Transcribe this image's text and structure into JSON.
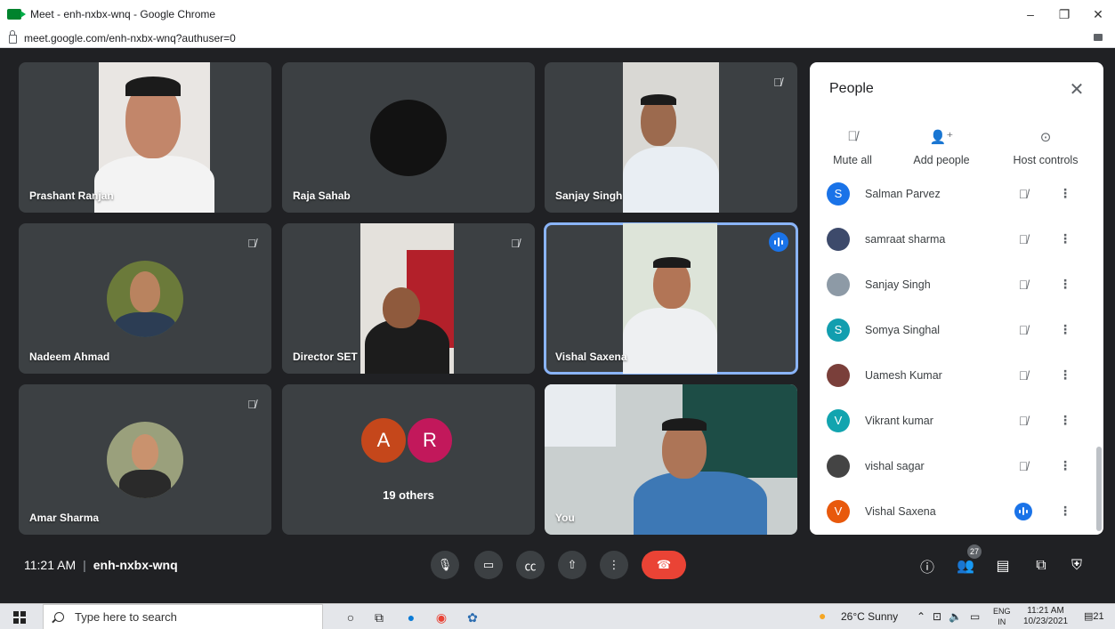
{
  "window": {
    "title": "Meet - enh-nxbx-wnq - Google Chrome",
    "controls": {
      "minimize": "–",
      "restore": "❐",
      "close": "✕"
    }
  },
  "address_bar": {
    "url": "meet.google.com/enh-nxbx-wnq?authuser=0"
  },
  "tiles": {
    "t1": {
      "name": "Prashant Ranjan"
    },
    "t2": {
      "name": "Raja Sahab"
    },
    "t3": {
      "name": "Sanjay Singh"
    },
    "t4": {
      "name": "Nadeem Ahmad"
    },
    "t5": {
      "name": "Director SET"
    },
    "t6": {
      "name": "Vishal Saxena"
    },
    "t7": {
      "name": "Amar Sharma"
    },
    "t8": {
      "label": "19 others",
      "avatars": [
        "A",
        "R"
      ]
    },
    "t9": {
      "name": "You"
    }
  },
  "people_panel": {
    "title": "People",
    "actions": {
      "mute_all": "Mute all",
      "add_people": "Add people",
      "host_controls": "Host controls"
    },
    "participants": [
      {
        "name": "Salman Parvez",
        "initial": "S",
        "color": "#1a73e8"
      },
      {
        "name": "samraat sharma",
        "initial": "",
        "color": "#3d4a6b"
      },
      {
        "name": "Sanjay Singh",
        "initial": "",
        "color": "#8d9aa6"
      },
      {
        "name": "Somya Singhal",
        "initial": "S",
        "color": "#129eaf"
      },
      {
        "name": "Uamesh Kumar",
        "initial": "",
        "color": "#7a3f3a"
      },
      {
        "name": "Vikrant kumar",
        "initial": "V",
        "color": "#12a4af"
      },
      {
        "name": "vishal sagar",
        "initial": "",
        "color": "#444"
      },
      {
        "name": "Vishal Saxena",
        "initial": "V",
        "color": "#e8590c"
      }
    ]
  },
  "bottom_bar": {
    "time": "11:21 AM",
    "separator": "|",
    "meeting_code": "enh-nxbx-wnq",
    "participant_count": "27"
  },
  "taskbar": {
    "search_placeholder": "Type here to search",
    "weather": "26°C  Sunny",
    "lang_top": "ENG",
    "lang_bottom": "IN",
    "time": "11:21 AM",
    "date": "10/23/2021",
    "notifications": "21"
  },
  "colors": {
    "meet_bg": "#202124",
    "tile_bg": "#3c4043",
    "accent_blue": "#1a73e8",
    "end_call_red": "#ea4335",
    "active_border": "#8ab4f8"
  }
}
